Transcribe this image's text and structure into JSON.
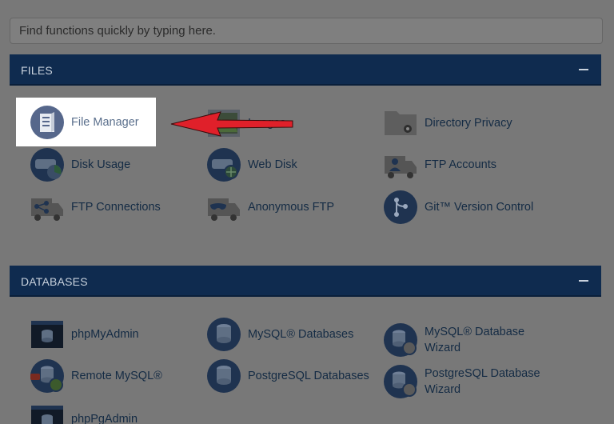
{
  "search": {
    "placeholder": "Find functions quickly by typing here."
  },
  "files": {
    "title": "FILES",
    "items": [
      {
        "label": "File Manager",
        "icon": "file-manager-icon"
      },
      {
        "label": "Images",
        "icon": "images-icon"
      },
      {
        "label": "Directory Privacy",
        "icon": "directory-privacy-icon"
      },
      {
        "label": "Disk Usage",
        "icon": "disk-usage-icon"
      },
      {
        "label": "Web Disk",
        "icon": "web-disk-icon"
      },
      {
        "label": "FTP Accounts",
        "icon": "ftp-accounts-icon"
      },
      {
        "label": "FTP Connections",
        "icon": "ftp-connections-icon"
      },
      {
        "label": "Anonymous FTP",
        "icon": "anonymous-ftp-icon"
      },
      {
        "label": "Git™ Version Control",
        "icon": "git-icon"
      }
    ]
  },
  "databases": {
    "title": "DATABASES",
    "items": [
      {
        "label": "phpMyAdmin",
        "icon": "phpmyadmin-icon"
      },
      {
        "label": "MySQL® Databases",
        "icon": "mysql-databases-icon"
      },
      {
        "label": "MySQL® Database Wizard",
        "icon": "mysql-wizard-icon"
      },
      {
        "label": "Remote MySQL®",
        "icon": "remote-mysql-icon"
      },
      {
        "label": "PostgreSQL Databases",
        "icon": "postgresql-databases-icon"
      },
      {
        "label": "PostgreSQL Database Wizard",
        "icon": "postgresql-wizard-icon"
      },
      {
        "label": "phpPgAdmin",
        "icon": "phppgadmin-icon"
      }
    ]
  },
  "colors": {
    "overlay": "#787878",
    "panel_header": "#0f2b4f",
    "highlight": "#ffffff",
    "arrow": "#e0202a"
  }
}
